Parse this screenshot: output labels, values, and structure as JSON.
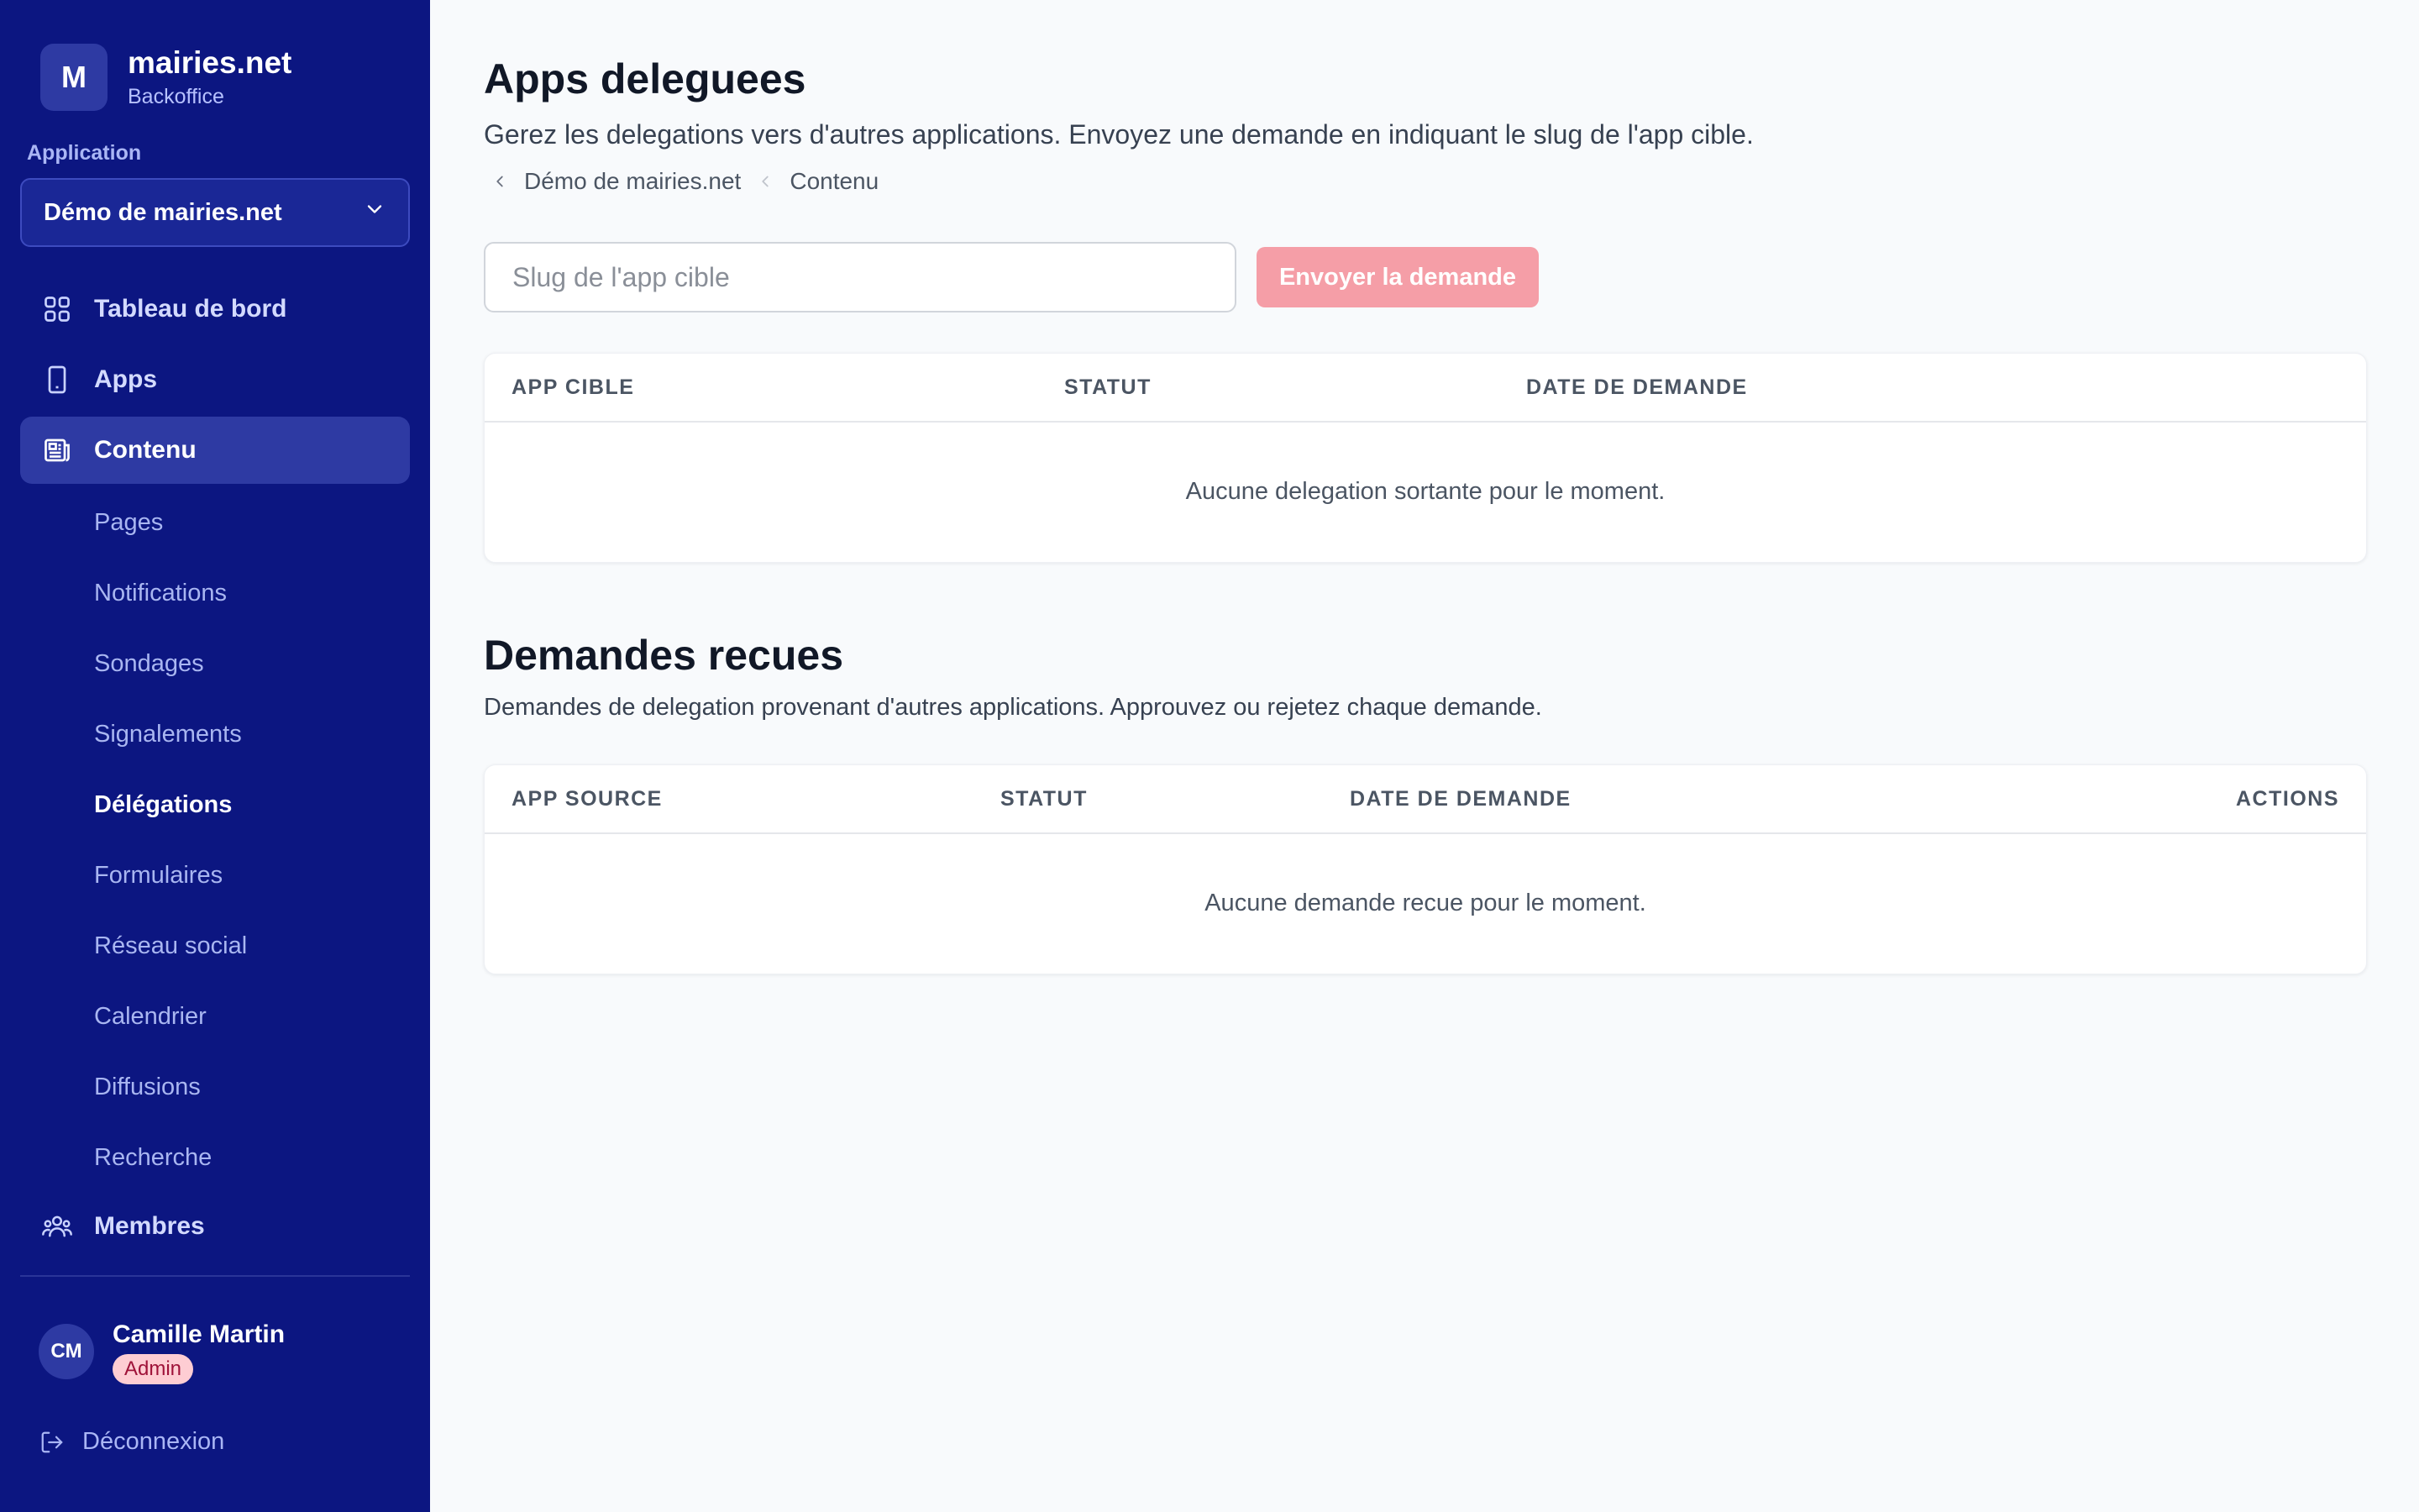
{
  "brand": {
    "logo_letter": "M",
    "name": "mairies.net",
    "subtitle": "Backoffice"
  },
  "app_selector": {
    "label": "Application",
    "value": "Démo de mairies.net"
  },
  "nav": {
    "dashboard": "Tableau de bord",
    "apps": "Apps",
    "content": "Contenu",
    "members": "Membres"
  },
  "sub_nav": [
    {
      "label": "Pages"
    },
    {
      "label": "Notifications"
    },
    {
      "label": "Sondages"
    },
    {
      "label": "Signalements"
    },
    {
      "label": "Délégations",
      "active": true
    },
    {
      "label": "Formulaires"
    },
    {
      "label": "Réseau social"
    },
    {
      "label": "Calendrier"
    },
    {
      "label": "Diffusions"
    },
    {
      "label": "Recherche"
    }
  ],
  "user": {
    "initials": "CM",
    "name": "Camille Martin",
    "role": "Admin"
  },
  "logout": "Déconnexion",
  "page": {
    "title": "Apps deleguees",
    "description": "Gerez les delegations vers d'autres applications. Envoyez une demande en indiquant le slug de l'app cible.",
    "breadcrumb": [
      "Démo de mairies.net",
      "Contenu"
    ]
  },
  "request_form": {
    "placeholder": "Slug de l'app cible",
    "value": "",
    "button": "Envoyer la demande"
  },
  "outgoing_table": {
    "columns": [
      "APP CIBLE",
      "STATUT",
      "DATE DE DEMANDE"
    ],
    "empty": "Aucune delegation sortante pour le moment."
  },
  "incoming": {
    "title": "Demandes recues",
    "description": "Demandes de delegation provenant d'autres applications. Approuvez ou rejetez chaque demande."
  },
  "incoming_table": {
    "columns": [
      "APP SOURCE",
      "STATUT",
      "DATE DE DEMANDE",
      "ACTIONS"
    ],
    "empty": "Aucune demande recue pour le moment."
  },
  "colors": {
    "sidebar_bg": "#0c1681",
    "sidebar_active": "#2e3aa3",
    "primary_button": "#f59ea7",
    "page_bg": "#f8fafc",
    "admin_badge_bg": "#fecdd3"
  },
  "icons": {
    "dashboard": "grid-icon",
    "apps": "smartphone-icon",
    "content": "newspaper-icon",
    "members": "users-icon",
    "logout": "logout-icon",
    "select": "chevron-down-icon",
    "breadcrumb": "chevron-left-icon"
  }
}
